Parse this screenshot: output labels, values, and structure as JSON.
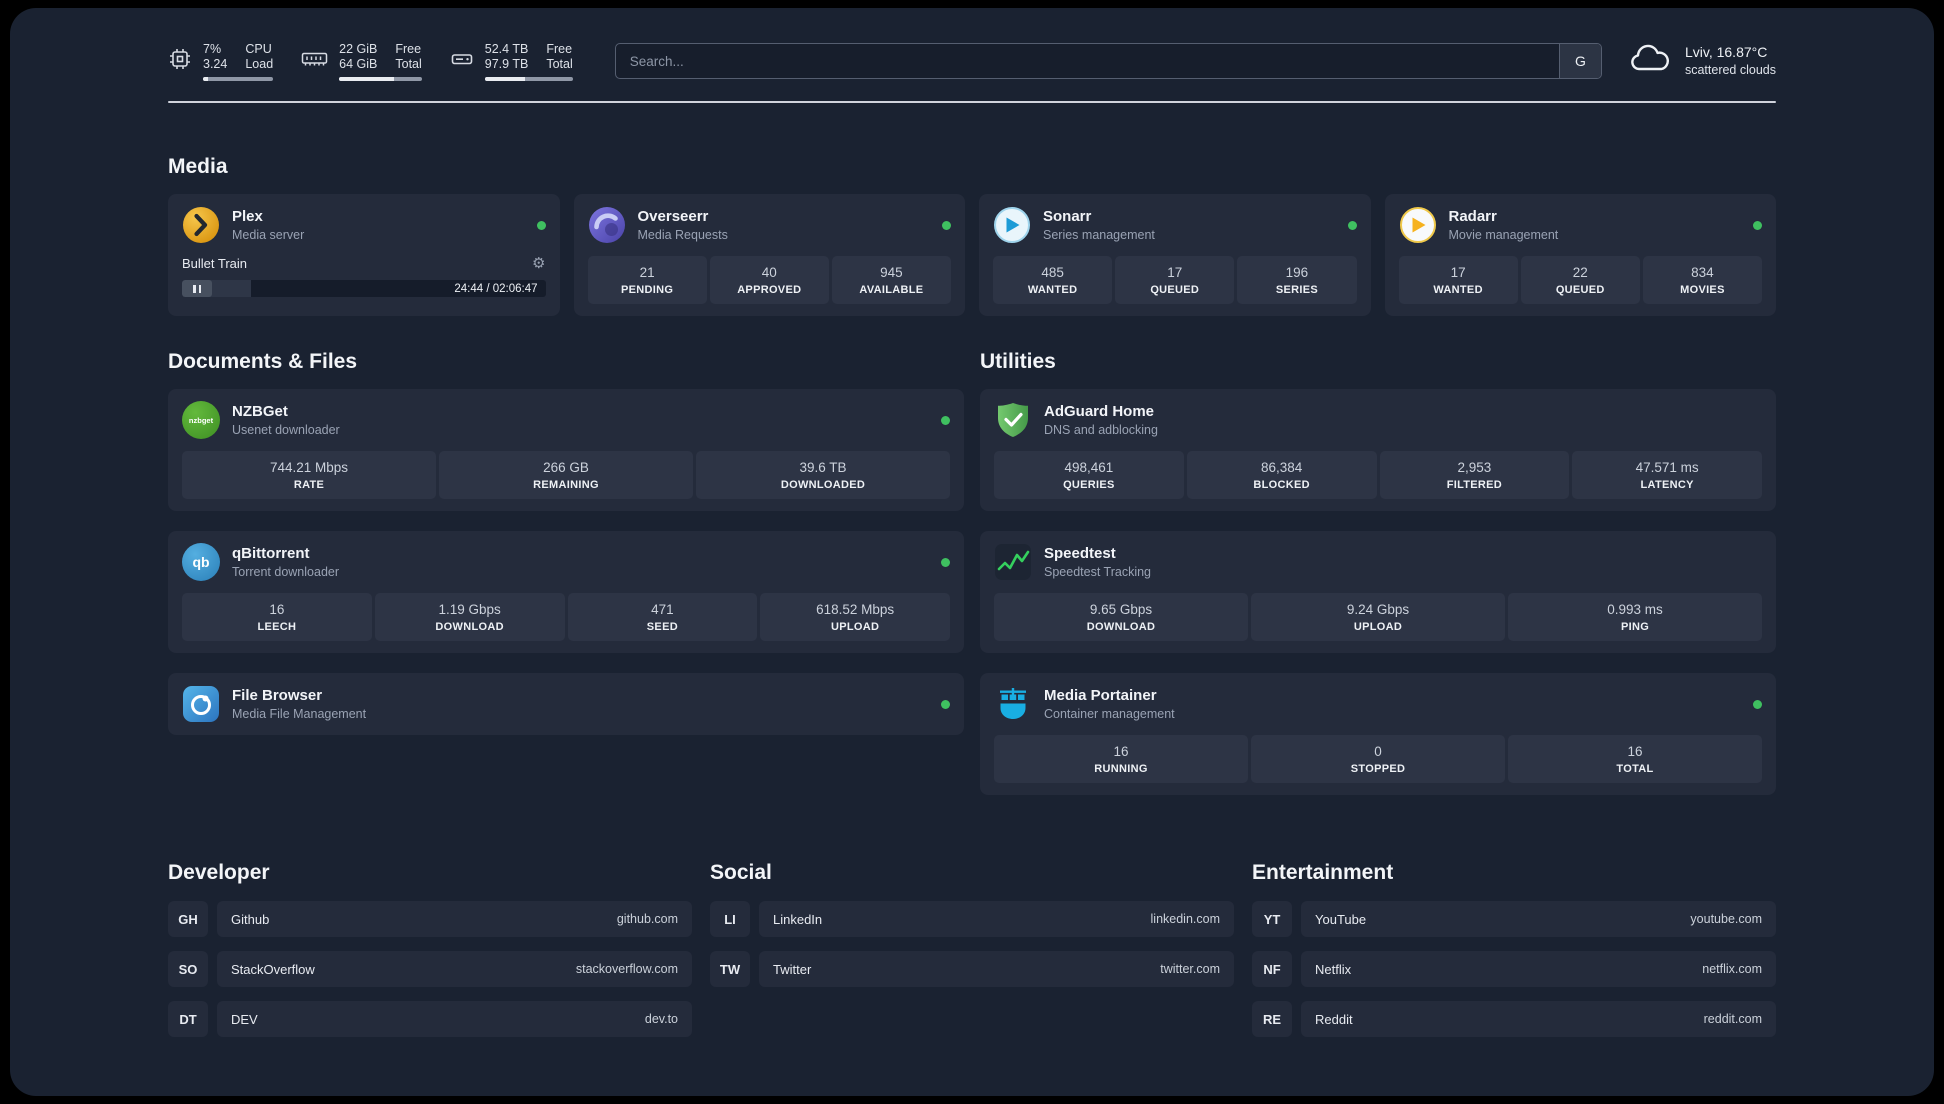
{
  "topbar": {
    "cpu": {
      "value_top": "7%",
      "value_bottom": "3.24",
      "label_top": "CPU",
      "label_bottom": "Load",
      "bar_pct": 7
    },
    "ram": {
      "value_top": "22 GiB",
      "value_bottom": "64 GiB",
      "label_top": "Free",
      "label_bottom": "Total",
      "bar_pct": 66
    },
    "disk": {
      "value_top": "52.4 TB",
      "value_bottom": "97.9 TB",
      "label_top": "Free",
      "label_bottom": "Total",
      "bar_pct": 46
    },
    "search": {
      "placeholder": "Search...",
      "button": "G"
    },
    "weather": {
      "location": "Lviv, 16.87°C",
      "condition": "scattered clouds"
    }
  },
  "icons": {
    "gear": "⚙",
    "nzbget_text": "nzbget",
    "qbittorrent_text": "qb"
  },
  "sections": {
    "media": {
      "title": "Media",
      "plex": {
        "name": "Plex",
        "desc": "Media server",
        "status": "online",
        "now_playing": "Bullet Train",
        "time": "24:44 / 02:06:47",
        "progress_pct": 19
      },
      "overseerr": {
        "name": "Overseerr",
        "desc": "Media Requests",
        "status": "online",
        "stats": [
          {
            "value": "21",
            "label": "PENDING"
          },
          {
            "value": "40",
            "label": "APPROVED"
          },
          {
            "value": "945",
            "label": "AVAILABLE"
          }
        ]
      },
      "sonarr": {
        "name": "Sonarr",
        "desc": "Series management",
        "status": "online",
        "stats": [
          {
            "value": "485",
            "label": "WANTED"
          },
          {
            "value": "17",
            "label": "QUEUED"
          },
          {
            "value": "196",
            "label": "SERIES"
          }
        ]
      },
      "radarr": {
        "name": "Radarr",
        "desc": "Movie management",
        "status": "online",
        "stats": [
          {
            "value": "17",
            "label": "WANTED"
          },
          {
            "value": "22",
            "label": "QUEUED"
          },
          {
            "value": "834",
            "label": "MOVIES"
          }
        ]
      }
    },
    "documents": {
      "title": "Documents & Files",
      "nzbget": {
        "name": "NZBGet",
        "desc": "Usenet downloader",
        "status": "online",
        "stats": [
          {
            "value": "744.21 Mbps",
            "label": "RATE"
          },
          {
            "value": "266 GB",
            "label": "REMAINING"
          },
          {
            "value": "39.6 TB",
            "label": "DOWNLOADED"
          }
        ]
      },
      "qbittorrent": {
        "name": "qBittorrent",
        "desc": "Torrent downloader",
        "status": "online",
        "stats": [
          {
            "value": "16",
            "label": "LEECH"
          },
          {
            "value": "1.19 Gbps",
            "label": "DOWNLOAD"
          },
          {
            "value": "471",
            "label": "SEED"
          },
          {
            "value": "618.52 Mbps",
            "label": "UPLOAD"
          }
        ]
      },
      "filebrowser": {
        "name": "File Browser",
        "desc": "Media File Management",
        "status": "online"
      }
    },
    "utilities": {
      "title": "Utilities",
      "adguard": {
        "name": "AdGuard Home",
        "desc": "DNS and adblocking",
        "stats": [
          {
            "value": "498,461",
            "label": "QUERIES"
          },
          {
            "value": "86,384",
            "label": "BLOCKED"
          },
          {
            "value": "2,953",
            "label": "FILTERED"
          },
          {
            "value": "47.571 ms",
            "label": "LATENCY"
          }
        ]
      },
      "speedtest": {
        "name": "Speedtest",
        "desc": "Speedtest Tracking",
        "stats": [
          {
            "value": "9.65 Gbps",
            "label": "DOWNLOAD"
          },
          {
            "value": "9.24 Gbps",
            "label": "UPLOAD"
          },
          {
            "value": "0.993 ms",
            "label": "PING"
          }
        ]
      },
      "portainer": {
        "name": "Media Portainer",
        "desc": "Container management",
        "status": "online",
        "stats": [
          {
            "value": "16",
            "label": "RUNNING"
          },
          {
            "value": "0",
            "label": "STOPPED"
          },
          {
            "value": "16",
            "label": "TOTAL"
          }
        ]
      }
    },
    "developer": {
      "title": "Developer",
      "links": [
        {
          "abbr": "GH",
          "name": "Github",
          "url": "github.com"
        },
        {
          "abbr": "SO",
          "name": "StackOverflow",
          "url": "stackoverflow.com"
        },
        {
          "abbr": "DT",
          "name": "DEV",
          "url": "dev.to"
        }
      ]
    },
    "social": {
      "title": "Social",
      "links": [
        {
          "abbr": "LI",
          "name": "LinkedIn",
          "url": "linkedin.com"
        },
        {
          "abbr": "TW",
          "name": "Twitter",
          "url": "twitter.com"
        }
      ]
    },
    "entertainment": {
      "title": "Entertainment",
      "links": [
        {
          "abbr": "YT",
          "name": "YouTube",
          "url": "youtube.com"
        },
        {
          "abbr": "NF",
          "name": "Netflix",
          "url": "netflix.com"
        },
        {
          "abbr": "RE",
          "name": "Reddit",
          "url": "reddit.com"
        }
      ]
    }
  },
  "colors": {
    "background": "#1a2231",
    "card": "#242b3b",
    "stat_tile": "#2d3445",
    "status_online": "#3fc060",
    "speedtest_line": "#35d05e",
    "plex_amber": "#e5a00d",
    "overseerr_purple": "#5b54c0",
    "sonarr_blue": "#1c9bd6",
    "radarr_amber": "#f6b21e",
    "nzbget_green": "#4da32f",
    "qbittorrent_blue": "#3b9bd6",
    "adguard_green": "#55b25a",
    "portainer_blue": "#19aee2"
  }
}
